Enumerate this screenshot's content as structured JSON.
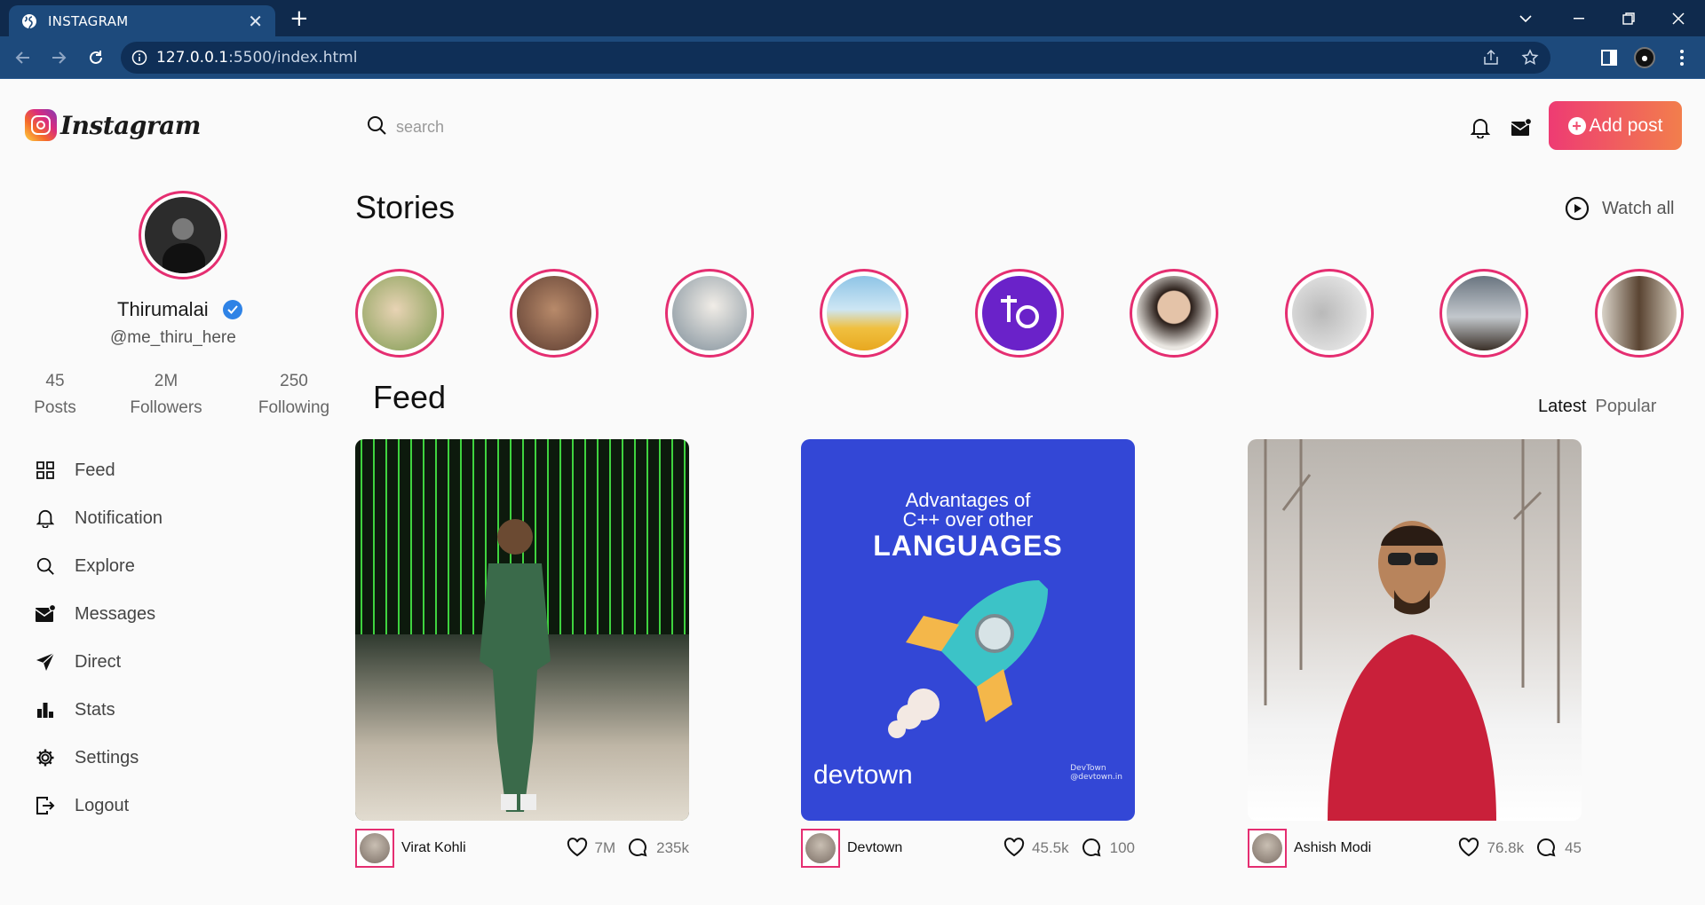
{
  "browser": {
    "tab_title": "INSTAGRAM",
    "url_host": "127.0.0.1",
    "url_rest": ":5500/index.html"
  },
  "app": {
    "logo_text": "Instagram",
    "search_placeholder": "search",
    "add_post_label": "Add post",
    "accent": "#e52e71"
  },
  "profile": {
    "name": "Thirumalai",
    "handle": "@me_thiru_here",
    "stats": [
      {
        "value": "45",
        "label": "Posts"
      },
      {
        "value": "2M",
        "label": "Followers"
      },
      {
        "value": "250",
        "label": "Following"
      }
    ]
  },
  "menu": [
    {
      "label": "Feed",
      "icon": "grid-icon"
    },
    {
      "label": "Notification",
      "icon": "bell-icon"
    },
    {
      "label": "Explore",
      "icon": "search-icon"
    },
    {
      "label": "Messages",
      "icon": "mail-icon"
    },
    {
      "label": "Direct",
      "icon": "send-icon"
    },
    {
      "label": "Stats",
      "icon": "bar-chart-icon"
    },
    {
      "label": "Settings",
      "icon": "gear-icon"
    },
    {
      "label": "Logout",
      "icon": "logout-icon"
    }
  ],
  "stories": {
    "title": "Stories",
    "watch_all": "Watch all"
  },
  "feed": {
    "title": "Feed",
    "tab_latest": "Latest",
    "tab_popular": "Popular",
    "posts": [
      {
        "user": "Virat Kohli",
        "likes": "7M",
        "comments": "235k"
      },
      {
        "user": "Devtown",
        "likes": "45.5k",
        "comments": "100",
        "image_text": {
          "line1": "Advantages of",
          "line2": "C++ over other",
          "line3": "LANGUAGES",
          "brand": "devtown",
          "small1": "DevTown",
          "small2": "@devtown.in"
        }
      },
      {
        "user": "Ashish Modi",
        "likes": "76.8k",
        "comments": "45"
      }
    ]
  }
}
